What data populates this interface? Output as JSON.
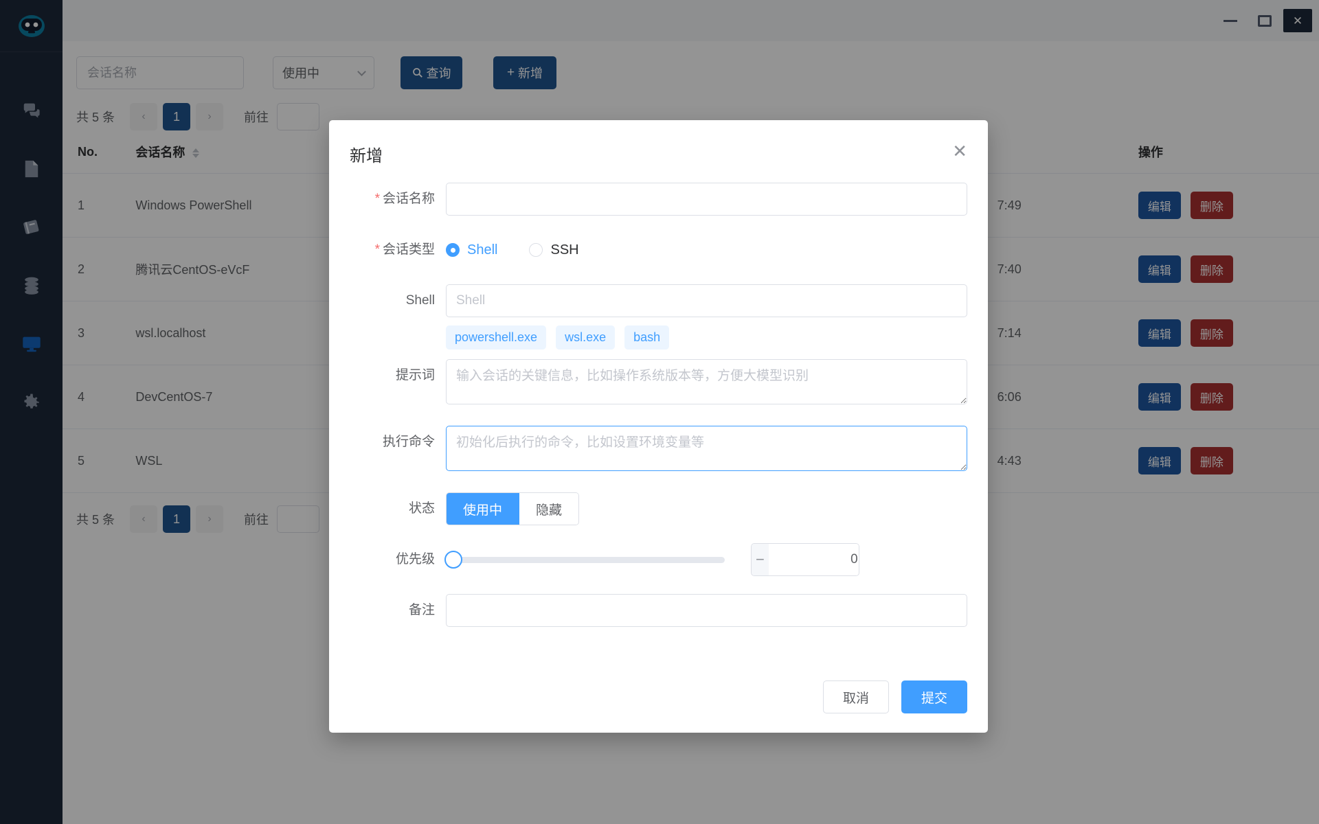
{
  "window": {
    "minimize_label": "—",
    "maximize_label": "❐",
    "close_label": "✕"
  },
  "sidebar": {
    "logo_name": "bot-logo",
    "items": [
      {
        "name": "chat",
        "icon": "chat-bubbles-icon",
        "active": false
      },
      {
        "name": "document",
        "icon": "document-icon",
        "active": false
      },
      {
        "name": "notebook",
        "icon": "notebook-icon",
        "active": false
      },
      {
        "name": "database",
        "icon": "database-icon",
        "active": false
      },
      {
        "name": "terminal",
        "icon": "monitor-icon",
        "active": true
      },
      {
        "name": "settings",
        "icon": "gear-icon",
        "active": false
      }
    ]
  },
  "toolbar": {
    "search_placeholder": "会话名称",
    "search_value": "",
    "status_filter_value": "使用中",
    "query_label": "查询",
    "query_icon": "search-icon",
    "add_label": "新增",
    "add_icon": "plus-icon"
  },
  "pagination": {
    "total_label": "共 5 条",
    "prev_label": "‹",
    "next_label": "›",
    "current_page": "1",
    "goto_label": "前往",
    "goto_value": ""
  },
  "table": {
    "columns": [
      "No.",
      "会话名称",
      "",
      "操作"
    ],
    "sort_column": "会话名称",
    "rows": [
      {
        "no": "1",
        "name": "Windows PowerShell",
        "time": "7:49",
        "edit": "编辑",
        "delete": "删除"
      },
      {
        "no": "2",
        "name": "腾讯云CentOS-eVcF",
        "time": "7:40",
        "edit": "编辑",
        "delete": "删除"
      },
      {
        "no": "3",
        "name": "wsl.localhost",
        "time": "7:14",
        "edit": "编辑",
        "delete": "删除"
      },
      {
        "no": "4",
        "name": "DevCentOS-7",
        "time": "6:06",
        "edit": "编辑",
        "delete": "删除"
      },
      {
        "no": "5",
        "name": "WSL",
        "time": "4:43",
        "edit": "编辑",
        "delete": "删除"
      }
    ]
  },
  "modal": {
    "title": "新增",
    "close_label": "✕",
    "fields": {
      "session_name": {
        "label": "会话名称",
        "required": true,
        "value": "",
        "placeholder": ""
      },
      "session_type": {
        "label": "会话类型",
        "required": true,
        "options": [
          {
            "label": "Shell",
            "checked": true
          },
          {
            "label": "SSH",
            "checked": false
          }
        ]
      },
      "shell": {
        "label": "Shell",
        "value": "",
        "placeholder": "Shell",
        "suggestions": [
          "powershell.exe",
          "wsl.exe",
          "bash"
        ]
      },
      "prompt": {
        "label": "提示词",
        "value": "",
        "placeholder": "输入会话的关键信息，比如操作系统版本等，方便大模型识别"
      },
      "exec_command": {
        "label": "执行命令",
        "value": "",
        "placeholder": "初始化后执行的命令，比如设置环境变量等",
        "focused": true
      },
      "status": {
        "label": "状态",
        "options": [
          {
            "label": "使用中",
            "active": true
          },
          {
            "label": "隐藏",
            "active": false
          }
        ]
      },
      "priority": {
        "label": "优先级",
        "value": "0",
        "min": "0",
        "decrement_label": "−",
        "increment_label": "+"
      },
      "remark": {
        "label": "备注",
        "value": "",
        "placeholder": ""
      }
    },
    "footer": {
      "cancel_label": "取消",
      "submit_label": "提交"
    }
  },
  "colors": {
    "sidebar_bg": "#1d2939",
    "accent_blue": "#409eff",
    "primary_button": "#20558f",
    "danger": "#a93131",
    "required_star": "#f56c6c"
  }
}
